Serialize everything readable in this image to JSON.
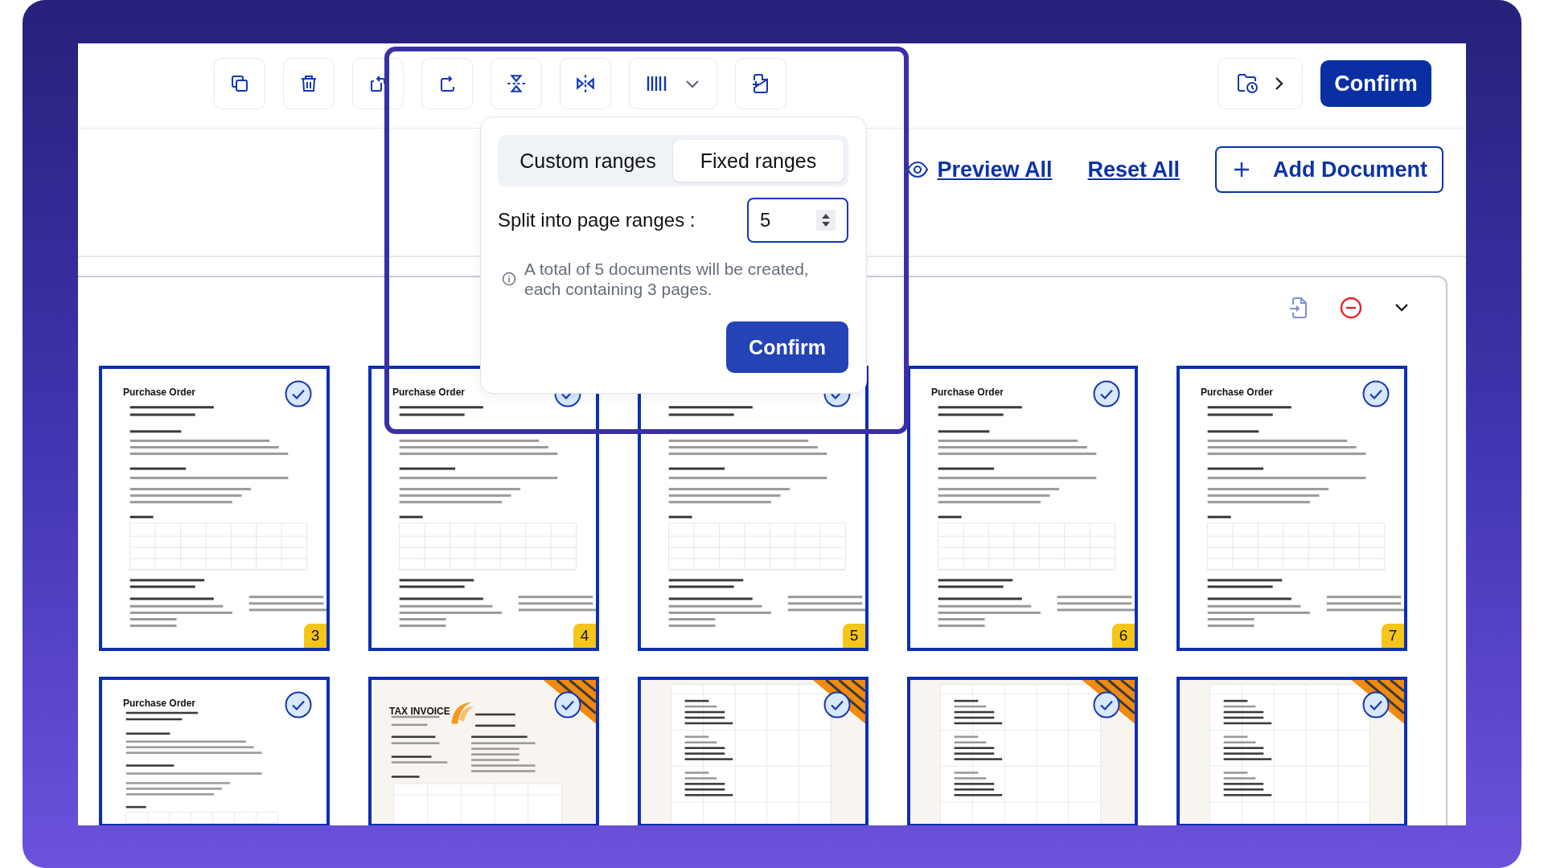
{
  "header": {
    "confirm_button": "Confirm"
  },
  "actions": {
    "preview_link": "Preview All",
    "reset_link": "Reset All",
    "add_button": "Add Document"
  },
  "split_popover": {
    "tabs": [
      {
        "label": "Custom ranges",
        "selected": false
      },
      {
        "label": "Fixed ranges",
        "selected": true
      }
    ],
    "range_label": "Split into page ranges :",
    "range_value": "5",
    "info": "A total of 5 documents will be created, each containing 3 pages.",
    "confirm_button": "Confirm"
  },
  "pages": [
    {
      "kind": "purchase_order",
      "title": "Purchase Order",
      "number": "3",
      "checked": true
    },
    {
      "kind": "purchase_order",
      "title": "Purchase Order",
      "number": "4",
      "checked": true
    },
    {
      "kind": "purchase_order",
      "number": "5",
      "checked": true
    },
    {
      "kind": "purchase_order",
      "title": "Purchase Order",
      "number": "6",
      "checked": true
    },
    {
      "kind": "purchase_order",
      "title": "Purchase Order",
      "number": "7",
      "checked": true
    },
    {
      "kind": "purchase_order",
      "title": "Purchase Order",
      "checked": true
    },
    {
      "kind": "invoice",
      "title": "TAX INVOICE",
      "checked": true
    },
    {
      "kind": "table",
      "checked": true
    },
    {
      "kind": "table",
      "checked": true
    },
    {
      "kind": "table",
      "checked": true
    }
  ]
}
